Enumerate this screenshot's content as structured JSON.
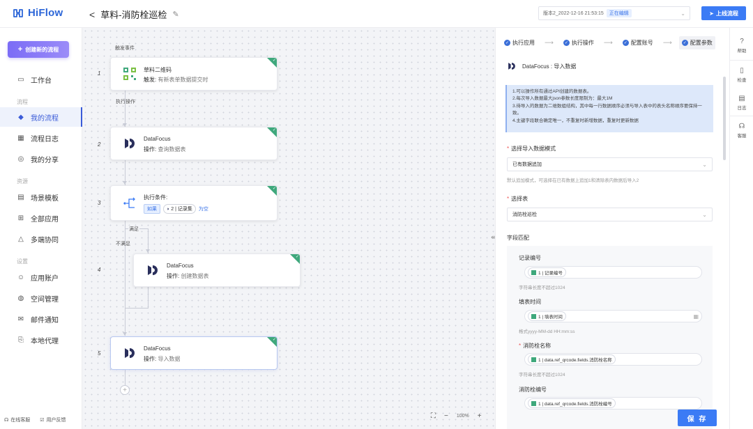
{
  "app": {
    "logo_text": "HiFlow",
    "brand_color": "#2c66d8"
  },
  "header": {
    "back_glyph": "<",
    "flow_title": "草料-消防栓巡检",
    "version_text": "版本2_2022-12-16 21:53:15",
    "version_badge": "正在编辑",
    "publish_label": "上线流程"
  },
  "sidebar": {
    "create_label": "创建新的流程",
    "workspace": "工作台",
    "section_flow": "流程",
    "my_flows": "我的流程",
    "flow_logs": "流程日志",
    "my_shares": "我的分享",
    "section_resources": "资源",
    "templates": "场景模板",
    "all_apps": "全部应用",
    "multi_collab": "多端协同",
    "section_settings": "设置",
    "app_accounts": "应用账户",
    "space_mgmt": "空间管理",
    "mail_notify": "邮件通知",
    "local_agent": "本地代理",
    "footer_service": "在线客服",
    "footer_feedback": "用户反馈"
  },
  "canvas": {
    "trigger_event": "触发事件",
    "exec_action": "执行操作",
    "node1": {
      "num": "1",
      "title": "草料二维码",
      "sub_prefix": "触发: ",
      "sub_value": "有新表单数据提交时"
    },
    "node2": {
      "num": "2",
      "title": "DataFocus",
      "sub_prefix": "操作: ",
      "sub_value": "查询数据表"
    },
    "node3": {
      "num": "3",
      "title": "执行条件:",
      "tag_if": "如果",
      "cond_text": "2 | 记录集",
      "cond_op": "为空"
    },
    "branch_yes": "满足",
    "branch_no": "不满足",
    "node4": {
      "num": "4",
      "title": "DataFocus",
      "sub_prefix": "操作: ",
      "sub_value": "创建数据表"
    },
    "node5": {
      "num": "5",
      "title": "DataFocus",
      "sub_prefix": "操作: ",
      "sub_value": "导入数据"
    },
    "zoom_level": "100%",
    "zoom_minus": "−",
    "zoom_plus": "+"
  },
  "panel": {
    "steps": [
      "执行应用",
      "执行操作",
      "配置账号",
      "配置参数"
    ],
    "app_line": "DataFocus  :  导入数据",
    "info_lines": [
      "1.可以操作所有通过API创建的数据表。",
      "2.每次导入数据最大json参数长度限制为：最大1M",
      "3.待导入的数据为二维数组结构，其中每一行数据顺序必须与导入表中的表头名称顺序要保持一致。",
      "4.主键字段联合确定唯一，不重复时新增数据，重复时更新数据"
    ],
    "mode_label": "选择导入数据模式",
    "mode_value": "已有数据追加",
    "mode_hint": "默认追加模式，可选择在已有数据上追加1和清除表内数据后导入2",
    "table_label": "选择表",
    "table_value": "消防栓巡检",
    "field_match": "字段匹配",
    "fields": [
      {
        "label": "记录编号",
        "chip": "1 | 记录编号",
        "hint": "字符串长度不超过1024"
      },
      {
        "label": "填表时间",
        "chip": "1 | 填表时间",
        "hint": "格式yyyy-MM-dd HH:mm:ss"
      },
      {
        "label": "消防栓名称",
        "chip": "1 | data.ref_qrcode.fields.消防栓名称",
        "hint": "字符串长度不超过1024"
      },
      {
        "label": "消防栓编号",
        "chip": "1 | data.ref_qrcode.fields.消防栓编号",
        "hint": ""
      }
    ],
    "save_label": "保 存"
  },
  "rail": {
    "help": "帮助",
    "check": "检查",
    "logs": "日志",
    "service": "客服"
  },
  "icons": {
    "logo": "hiflow-logo-icon",
    "edit": "pencil-icon",
    "send": "paper-plane-icon",
    "datafocus": "datafocus-logo-icon",
    "qrcode": "qrcode-logo-icon",
    "branch": "branch-icon"
  }
}
